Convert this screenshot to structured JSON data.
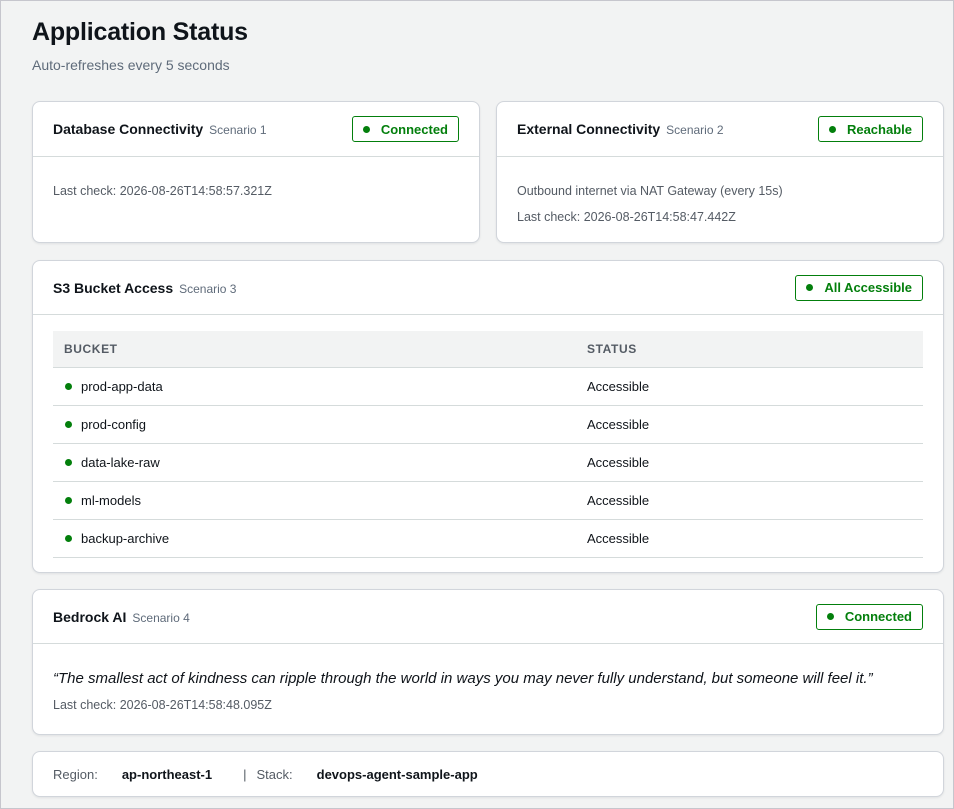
{
  "header": {
    "title": "Application Status",
    "subtitle": "Auto-refreshes every 5 seconds"
  },
  "database": {
    "title": "Database Connectivity",
    "scenario": "Scenario 1",
    "status": "Connected",
    "last_check": "Last check: 2026-08-26T14:58:57.321Z"
  },
  "external": {
    "title": "External Connectivity",
    "scenario": "Scenario 2",
    "status": "Reachable",
    "description": "Outbound internet via NAT Gateway (every 15s)",
    "last_check": "Last check: 2026-08-26T14:58:47.442Z"
  },
  "s3": {
    "title": "S3 Bucket Access",
    "scenario": "Scenario 3",
    "status": "All Accessible",
    "columns": [
      "BUCKET",
      "STATUS"
    ],
    "rows": [
      {
        "bucket": "prod-app-data",
        "status": "Accessible"
      },
      {
        "bucket": "prod-config",
        "status": "Accessible"
      },
      {
        "bucket": "data-lake-raw",
        "status": "Accessible"
      },
      {
        "bucket": "ml-models",
        "status": "Accessible"
      },
      {
        "bucket": "backup-archive",
        "status": "Accessible"
      }
    ]
  },
  "bedrock": {
    "title": "Bedrock AI",
    "scenario": "Scenario 4",
    "status": "Connected",
    "quote": "“The smallest act of kindness can ripple through the world in ways you may never fully understand, but someone will feel it.”",
    "last_check": "Last check: 2026-08-26T14:58:48.095Z"
  },
  "footer": {
    "region_label": "Region:",
    "region_value": "ap-northeast-1",
    "separator": "|",
    "stack_label": "Stack:",
    "stack_value": "devops-agent-sample-app"
  },
  "colors": {
    "success": "#037f0c",
    "background": "#f2f3f3",
    "border": "#d1d5db"
  },
  "icons": {
    "status_dot": "status-dot-icon"
  }
}
